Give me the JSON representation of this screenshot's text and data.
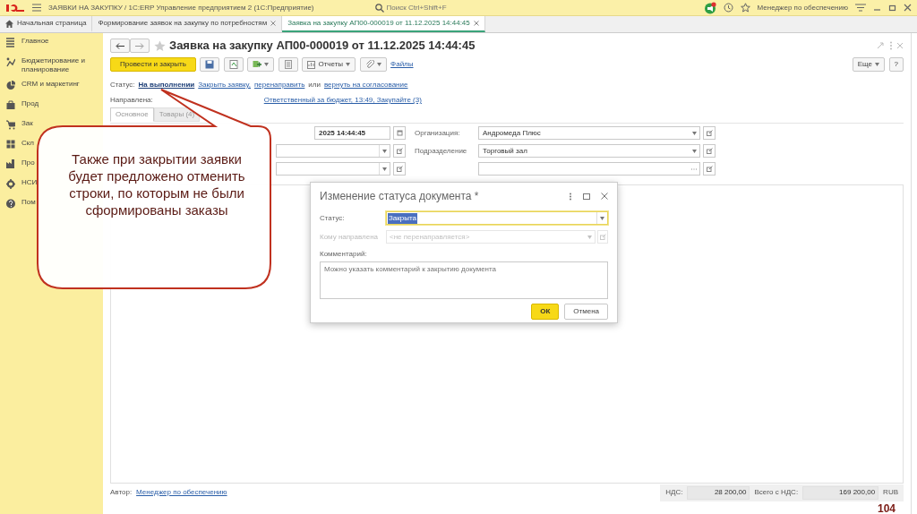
{
  "titlebar": {
    "title": "ЗАЯВКИ НА ЗАКУПКУ / 1С:ERP Управление предприятием 2  (1С:Предприятие)",
    "search_placeholder": "Поиск Ctrl+Shift+F",
    "user": "Менеджер по обеспечению"
  },
  "tabs": [
    {
      "label": "Начальная страница",
      "kind": "home",
      "selected": false,
      "closable": false
    },
    {
      "label": "Формирование заявок на закупку по потребностям",
      "kind": "page",
      "selected": false,
      "closable": true
    },
    {
      "label": "Заявка на закупку АП00-000019 от 11.12.2025 14:44:45",
      "kind": "page",
      "selected": true,
      "closable": true
    }
  ],
  "sidebar": {
    "items": [
      {
        "label": "Главное",
        "kind": "menu"
      },
      {
        "label": "Бюджетирование и планирование",
        "kind": "budget"
      },
      {
        "label": "CRM и маркетинг",
        "kind": "crm"
      },
      {
        "label": "Прод",
        "kind": "bag"
      },
      {
        "label": "Зак",
        "kind": "cart"
      },
      {
        "label": "Скл",
        "kind": "warehouse"
      },
      {
        "label": "Про",
        "kind": "factory"
      },
      {
        "label": "НСИ",
        "kind": "gear"
      },
      {
        "label": "Пом",
        "kind": "help"
      }
    ]
  },
  "document": {
    "title": "Заявка на закупку АП00-000019 от 11.12.2025 14:44:45",
    "toolbar": {
      "primary": "Провести и закрыть",
      "reports": "Отчеты",
      "files": "Файлы",
      "more": "Еще",
      "help": "?"
    },
    "status": [
      {
        "kind": "text",
        "text": "Статус:"
      },
      {
        "kind": "current",
        "text": "На выполнении"
      },
      {
        "kind": "link",
        "text": "Закрыть заявку,"
      },
      {
        "kind": "link",
        "text": "перенаправить"
      },
      {
        "kind": "text",
        "text": "или"
      },
      {
        "kind": "link",
        "text": "вернуть на согласование"
      }
    ],
    "routing": [
      {
        "kind": "text",
        "text": "Направлена:"
      },
      {
        "kind": "link",
        "text": "Ответственный за бюджет, 13:49, Закупайте (3)"
      }
    ],
    "form_tabs": [
      {
        "label": "Основное",
        "selected": true
      },
      {
        "label": "Товары (4)",
        "selected": false
      }
    ],
    "left_fields": [
      {
        "kind": "date",
        "value": "2025 14:44:45"
      },
      {
        "kind": "select"
      },
      {
        "kind": "select"
      }
    ],
    "right_fields": [
      {
        "label": "Организация:",
        "kind": "select",
        "value": "Андромеда Плюс"
      },
      {
        "label": "Подразделение",
        "kind": "select",
        "value": "Торговый зал"
      },
      {
        "kind": "choice"
      }
    ],
    "footer": {
      "author_label": "Автор:",
      "author": "Менеджер по обеспечению",
      "vat_label": "НДС:",
      "vat": "28 200,00",
      "total_label": "Всего с НДС:",
      "total": "169 200,00",
      "currency": "RUB"
    }
  },
  "dialog": {
    "title": "Изменение статуса документа *",
    "status_label": "Статус:",
    "status_value": "Закрыта",
    "recipient_label": "Кому направлена",
    "recipient_placeholder": "<не перенаправляется>",
    "recipient_disabled": true,
    "comment_label": "Комментарий:",
    "comment_placeholder": "Можно указать комментарий к закрытию документа",
    "ok": "ОК",
    "cancel": "Отмена"
  },
  "callout": {
    "text": "Также при закрытии заявки будет предложено отменить строки, по которым не были сформированы заказы"
  },
  "slide_number": "104"
}
